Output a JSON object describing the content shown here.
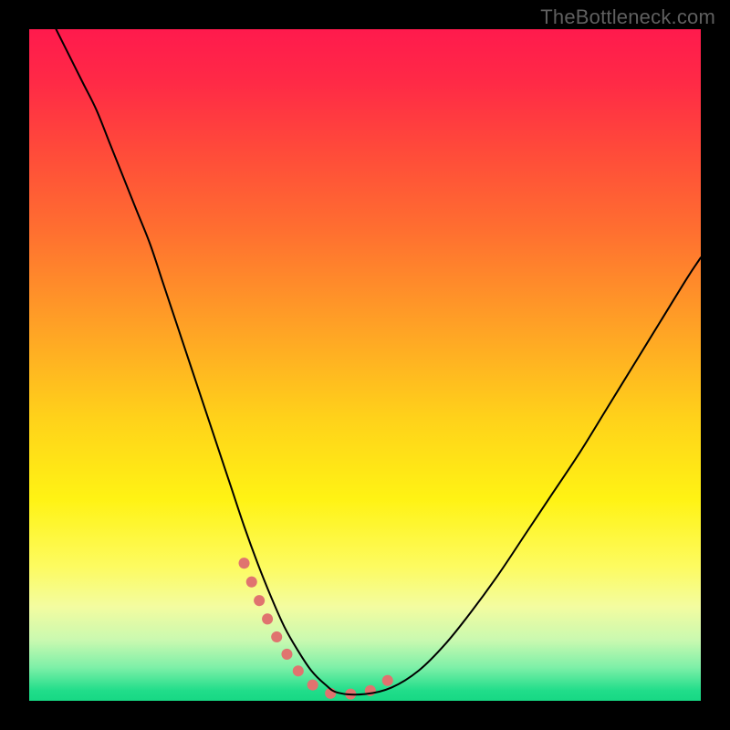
{
  "watermark": "TheBottleneck.com",
  "chart_data": {
    "type": "line",
    "title": "",
    "xlabel": "",
    "ylabel": "",
    "xlim": [
      0,
      100
    ],
    "ylim": [
      0,
      100
    ],
    "background_gradient": {
      "stops": [
        {
          "offset": 0.0,
          "color": "#ff1a4d"
        },
        {
          "offset": 0.08,
          "color": "#ff2a46"
        },
        {
          "offset": 0.18,
          "color": "#ff4a3a"
        },
        {
          "offset": 0.3,
          "color": "#ff6f30"
        },
        {
          "offset": 0.45,
          "color": "#ffa425"
        },
        {
          "offset": 0.58,
          "color": "#ffd21a"
        },
        {
          "offset": 0.7,
          "color": "#fff314"
        },
        {
          "offset": 0.8,
          "color": "#fdfb60"
        },
        {
          "offset": 0.86,
          "color": "#f3fca0"
        },
        {
          "offset": 0.91,
          "color": "#c9f9b0"
        },
        {
          "offset": 0.95,
          "color": "#7ef0a8"
        },
        {
          "offset": 0.985,
          "color": "#20dd8a"
        },
        {
          "offset": 1.0,
          "color": "#17d884"
        }
      ]
    },
    "series": [
      {
        "name": "bottleneck-curve",
        "stroke": "#000000",
        "stroke_width": 2,
        "x": [
          4,
          6,
          8,
          10,
          12,
          14,
          16,
          18,
          20,
          22,
          24,
          26,
          28,
          30,
          32,
          34,
          36,
          38,
          40,
          42,
          44,
          46,
          50,
          54,
          58,
          62,
          66,
          70,
          74,
          78,
          82,
          86,
          90,
          94,
          98,
          100
        ],
        "y": [
          100,
          96,
          92,
          88,
          83,
          78,
          73,
          68,
          62,
          56,
          50,
          44,
          38,
          32,
          26,
          20.5,
          15.5,
          11,
          7.5,
          4.5,
          2.5,
          1.2,
          1.0,
          2.0,
          4.5,
          8.5,
          13.5,
          19,
          25,
          31,
          37,
          43.5,
          50,
          56.5,
          63,
          66
        ]
      }
    ],
    "highlight_band": {
      "name": "optimal-zone-markers",
      "stroke": "#e0736f",
      "stroke_width": 12,
      "linecap": "round",
      "x": [
        32,
        34,
        36,
        38,
        40,
        42,
        44,
        46,
        48,
        50,
        52,
        54
      ],
      "y": [
        20.5,
        15.5,
        11.0,
        7.5,
        4.5,
        2.5,
        1.2,
        1.0,
        1.0,
        1.2,
        2.0,
        3.5
      ]
    }
  }
}
